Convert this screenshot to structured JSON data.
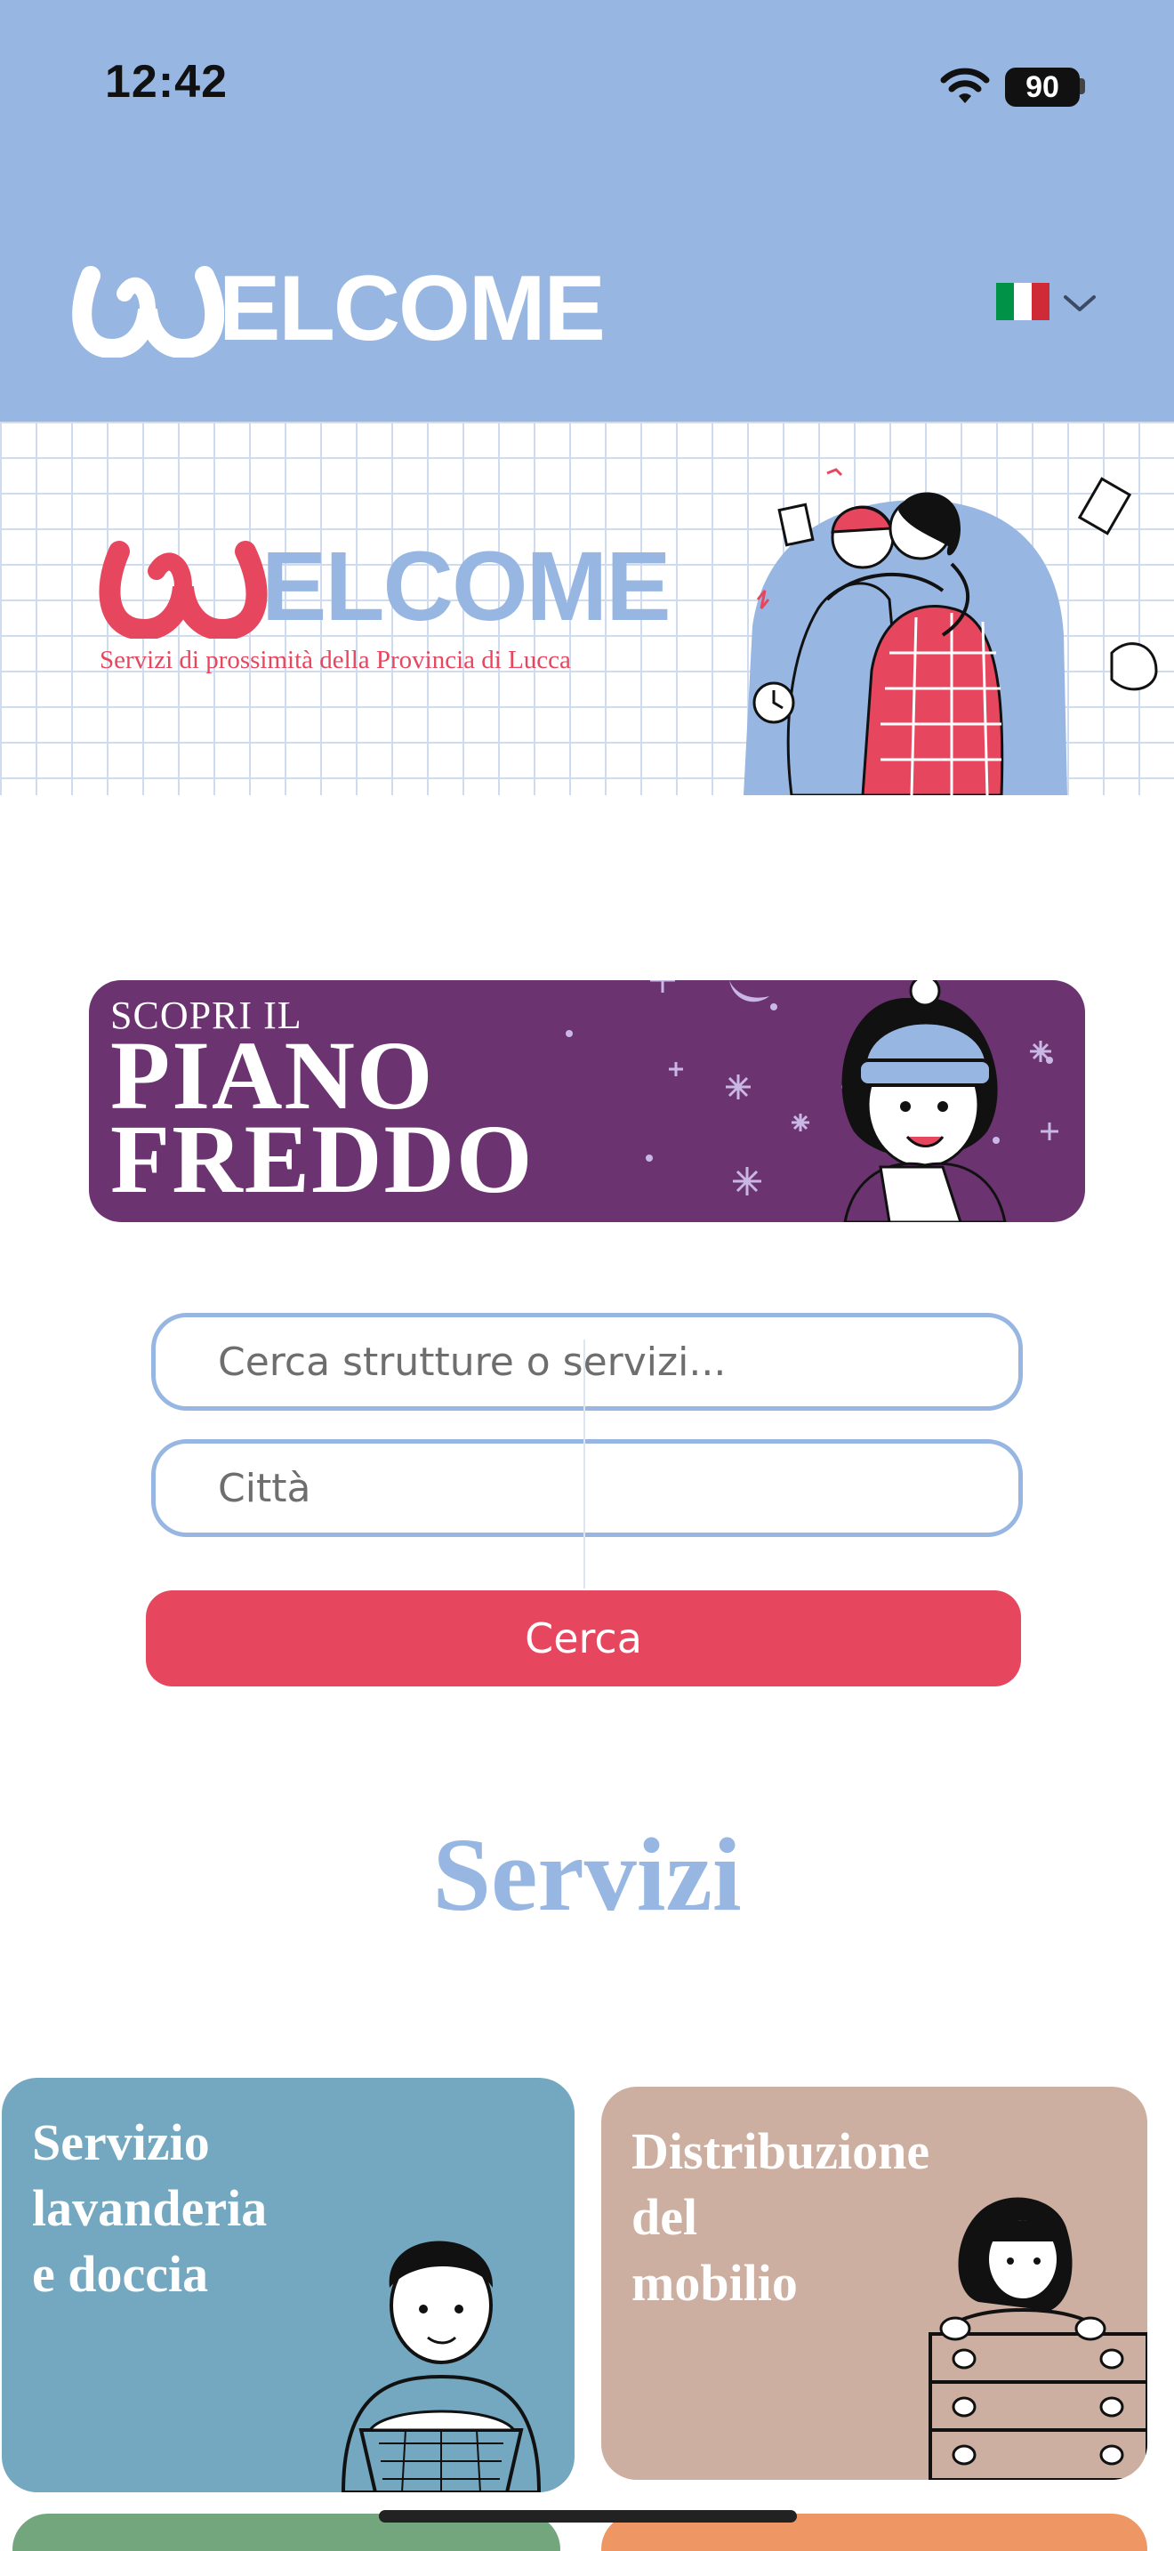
{
  "status_bar": {
    "time": "12:42",
    "battery": "90"
  },
  "header": {
    "logo_text": "ELCOME",
    "language": "Italiano",
    "flag_colors": [
      "#009246",
      "#ffffff",
      "#ce2b37"
    ]
  },
  "hero": {
    "logo_text": "ELCOME",
    "subtitle": "Servizi di prossimità della Provincia di Lucca"
  },
  "promo": {
    "kicker": "SCOPRI IL",
    "title_line1": "PIANO",
    "title_line2": "FREDDO"
  },
  "search": {
    "query_placeholder": "Cerca strutture o servizi...",
    "city_placeholder": "Città",
    "button_label": "Cerca"
  },
  "services": {
    "title": "Servizi",
    "cards": [
      {
        "label": "Servizio\nlavanderia\ne doccia",
        "color": "#74a7c0"
      },
      {
        "label": "Distribuzione\ndel\nmobilio",
        "color": "#ccafa1"
      },
      {
        "label": "",
        "color": "#74a67e"
      },
      {
        "label": "",
        "color": "#ee9664"
      }
    ]
  },
  "colors": {
    "accent": "#e6475e",
    "primary": "#97b7e2",
    "promo": "#6b3370"
  }
}
